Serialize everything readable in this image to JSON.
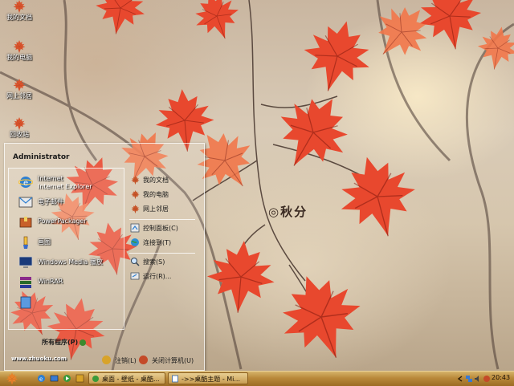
{
  "desktop": {
    "watermark": "◎秋分",
    "icons": [
      {
        "label": "我的文档"
      },
      {
        "label": "我的电脑"
      },
      {
        "label": "网上邻居"
      },
      {
        "label": "回收站"
      }
    ]
  },
  "start_menu": {
    "user": "Administrator",
    "programs": [
      {
        "line1": "Internet",
        "line2": "Internet Explorer",
        "icon": "ie-icon"
      },
      {
        "line1": "电子邮件",
        "line2": "",
        "icon": "email-icon"
      },
      {
        "line1": "PowerPackager",
        "line2": "",
        "icon": "package-icon"
      },
      {
        "line1": "画图",
        "line2": "",
        "icon": "paint-icon"
      },
      {
        "line1": "Windows Media 播放",
        "line2": "",
        "icon": "media-player-icon"
      },
      {
        "line1": "WinRAR",
        "line2": "",
        "icon": "winrar-icon"
      },
      {
        "line1": "",
        "line2": "",
        "icon": "program-icon"
      }
    ],
    "all_programs": "所有程序(P)",
    "right_items": [
      {
        "label": "我的文档"
      },
      {
        "label": "我的电脑"
      },
      {
        "label": "网上邻居"
      },
      {
        "label": "控制面板(C)"
      },
      {
        "label": "连接到(T)"
      },
      {
        "label": "搜索(S)"
      },
      {
        "label": "运行(R)..."
      }
    ],
    "url": "www.zhuoku.com",
    "logoff": "注销(L)",
    "shutdown": "关闭计算机(U)"
  },
  "taskbar": {
    "tasks": [
      {
        "label": "桌面 - 壁纸 - 桌酷..."
      },
      {
        "label": "->>桌酷主题 - Mi..."
      }
    ],
    "clock": "20:43"
  },
  "colors": {
    "leaf": "#e8482e",
    "leaf_light": "#f2774a",
    "taskbar": "#b9893a"
  }
}
